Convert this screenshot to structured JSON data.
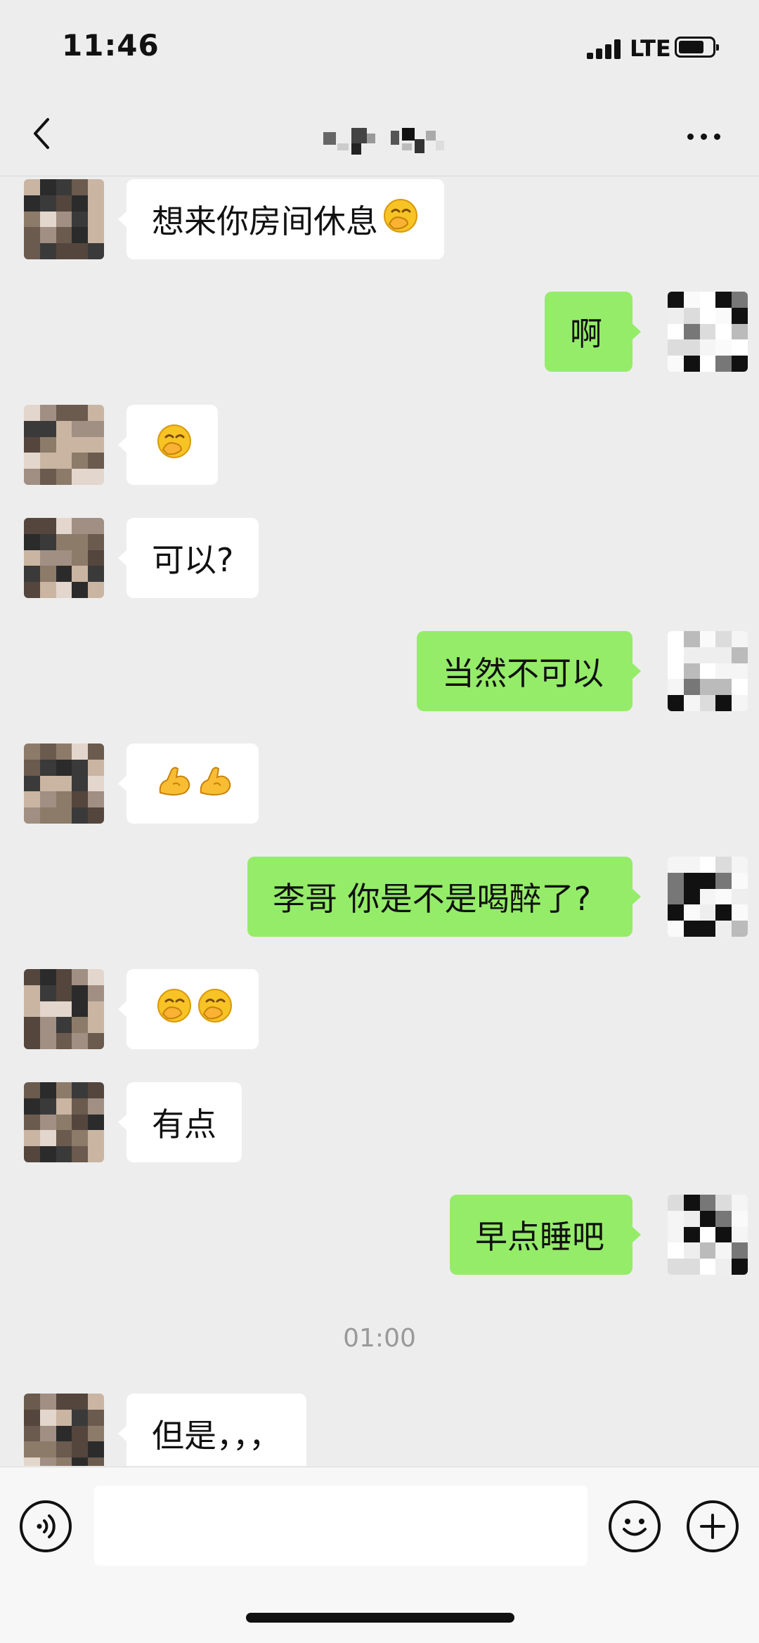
{
  "status_bar": {
    "time": "11:46",
    "network": "LTE",
    "battery_level": 0.75
  },
  "nav": {
    "back_icon": "chevron-left-icon",
    "title": "",
    "more_icon": "more-dots-icon"
  },
  "messages": [
    {
      "side": "left",
      "text": "想来你房间休息",
      "emoji": [
        "face-with-hand-over-mouth"
      ]
    },
    {
      "side": "right",
      "text": "啊",
      "emoji": []
    },
    {
      "side": "left",
      "text": "",
      "emoji": [
        "face-with-hand-over-mouth"
      ]
    },
    {
      "side": "left",
      "text": "可以?",
      "emoji": []
    },
    {
      "side": "right",
      "text": "当然不可以",
      "emoji": []
    },
    {
      "side": "left",
      "text": "",
      "emoji": [
        "flexed-biceps",
        "flexed-biceps"
      ]
    },
    {
      "side": "right",
      "text": "李哥 你是不是喝醉了?",
      "emoji": []
    },
    {
      "side": "left",
      "text": "",
      "emoji": [
        "face-with-hand-over-mouth",
        "face-with-hand-over-mouth"
      ]
    },
    {
      "side": "left",
      "text": "有点",
      "emoji": []
    },
    {
      "side": "right",
      "text": "早点睡吧",
      "emoji": []
    },
    {
      "type": "time",
      "text": "01:00"
    },
    {
      "side": "left",
      "text": "但是，，，",
      "emoji": []
    }
  ],
  "input_bar": {
    "voice_icon": "voice-icon",
    "input_value": "",
    "emoji_icon": "smiley-icon",
    "plus_icon": "plus-icon"
  },
  "colors": {
    "sent_bubble": "#95ec69",
    "received_bubble": "#ffffff",
    "background": "#ededed"
  }
}
